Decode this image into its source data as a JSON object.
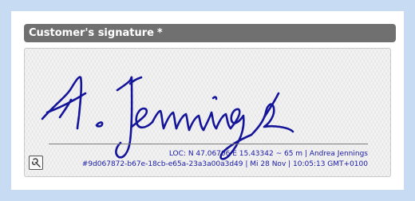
{
  "section": {
    "title": "Customer's signature",
    "required_marker": "*"
  },
  "signature": {
    "name": "A. Jennings",
    "ink_color": "#14149a",
    "location_line": "LOC: N 47.06706  E 15.43342  ~ 65 m | Andrea Jennings",
    "hash_line": "#9d067872-b67e-18cb-e65a-23a3a00a3d49 | Mi 28 Nov | 10:05:13 GMT+0100"
  },
  "tool": {
    "icon": "wrench-icon"
  }
}
